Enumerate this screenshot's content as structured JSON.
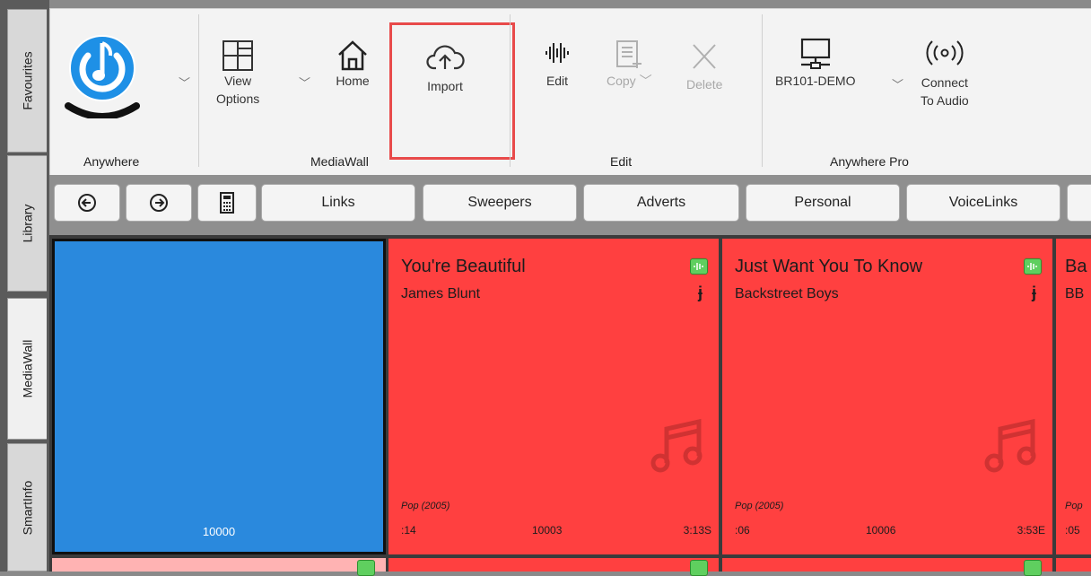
{
  "side_tabs": [
    {
      "label": "Favourites",
      "active": false
    },
    {
      "label": "Library",
      "active": false
    },
    {
      "label": "MediaWall",
      "active": true
    },
    {
      "label": "SmartInfo",
      "active": false
    }
  ],
  "ribbon": {
    "groups": {
      "anywhere": "Anywhere",
      "mediawall": "MediaWall",
      "edit": "Edit",
      "anywhere_pro": "Anywhere Pro"
    },
    "view_options": [
      "View",
      "Options"
    ],
    "home": "Home",
    "import": "Import",
    "edit": "Edit",
    "copy": "Copy",
    "delete": "Delete",
    "device": "BR101-DEMO",
    "connect": [
      "Connect",
      "To Audio"
    ]
  },
  "nav": {
    "back_icon": "back-arrow-icon",
    "forward_icon": "forward-arrow-icon",
    "calculator_icon": "calculator-icon",
    "categories": [
      "Links",
      "Sweepers",
      "Adverts",
      "Personal",
      "VoiceLinks"
    ]
  },
  "tiles": [
    {
      "number": "10000",
      "color": "#2a89dd",
      "selected": true
    },
    {
      "title": "You're Beautiful",
      "artist": "James Blunt",
      "genre": "Pop (2005)",
      "intro": ":14",
      "number": "10003",
      "duration": "3:13S",
      "color": "#ff4040"
    },
    {
      "title": "Just Want You To Know",
      "artist": "Backstreet Boys",
      "genre": "Pop (2005)",
      "intro": ":06",
      "number": "10006",
      "duration": "3:53E",
      "color": "#ff4040"
    },
    {
      "title": "Ba",
      "artist": "BB",
      "genre": "Pop",
      "intro": ":05",
      "color": "#ff4040"
    }
  ],
  "colors": {
    "highlight": "#e84a4a",
    "song_tile": "#ff4040",
    "selected_tile": "#2a89dd",
    "next_row_tile": "#ffb3b3"
  }
}
